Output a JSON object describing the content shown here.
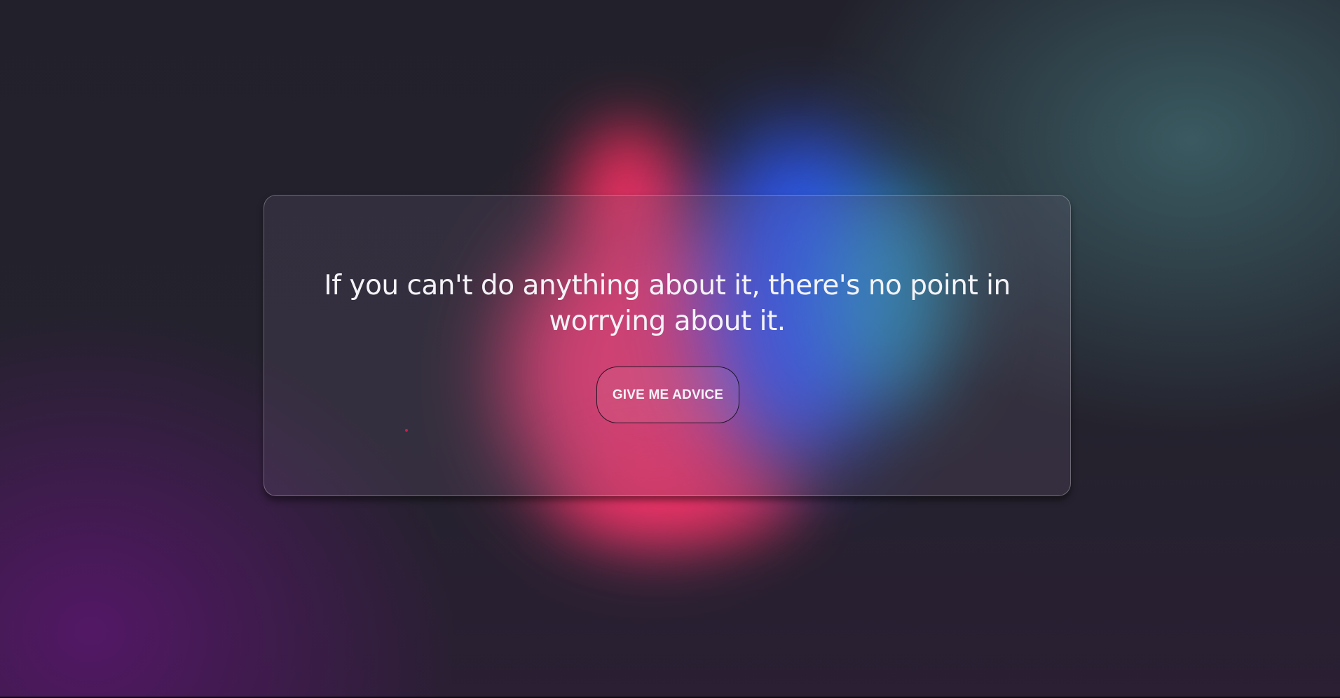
{
  "quote": {
    "text": "If you can't do anything about it, there's no point in worrying about it."
  },
  "button": {
    "label": "GIVE ME ADVICE"
  },
  "colors": {
    "background": "#22212c",
    "blob_red": "#ff3d78",
    "blob_blue": "#2e5bff",
    "blob_teal": "#2ec1d4",
    "glow_purple": "#5a166e",
    "text": "#f4f3f8"
  }
}
